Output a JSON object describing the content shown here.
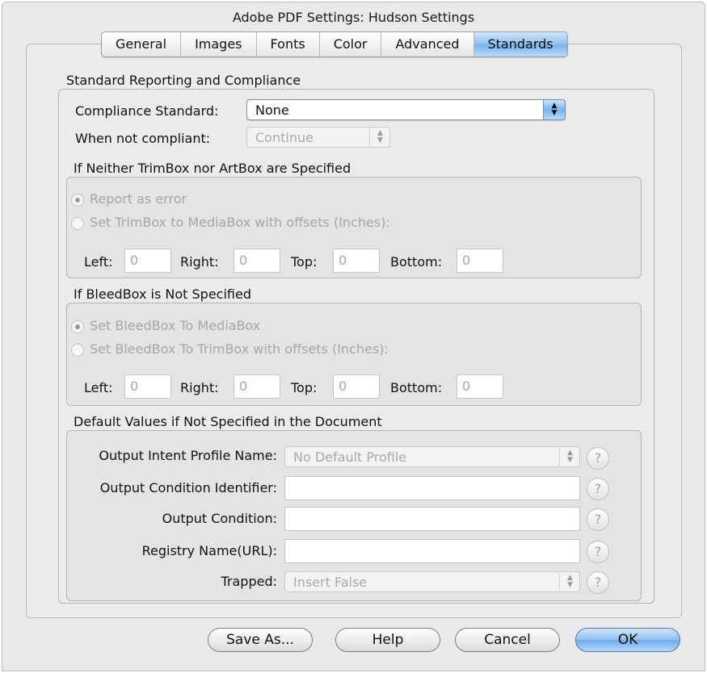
{
  "window": {
    "title": "Adobe PDF Settings: Hudson Settings"
  },
  "tabs": [
    "General",
    "Images",
    "Fonts",
    "Color",
    "Advanced",
    "Standards"
  ],
  "active_tab": "Standards",
  "reporting": {
    "title": "Standard Reporting and Compliance",
    "compliance_label": "Compliance Standard:",
    "compliance_value": "None",
    "not_compliant_label": "When not compliant:",
    "not_compliant_value": "Continue"
  },
  "trimbox": {
    "title": "If Neither TrimBox nor ArtBox are Specified",
    "option_error": "Report as error",
    "option_offsets": "Set TrimBox to MediaBox with offsets (Inches):",
    "left_label": "Left:",
    "left_value": "0",
    "right_label": "Right:",
    "right_value": "0",
    "top_label": "Top:",
    "top_value": "0",
    "bottom_label": "Bottom:",
    "bottom_value": "0"
  },
  "bleedbox": {
    "title": "If BleedBox is Not Specified",
    "option_media": "Set BleedBox To MediaBox",
    "option_offsets": "Set BleedBox To TrimBox with offsets (Inches):",
    "left_label": "Left:",
    "left_value": "0",
    "right_label": "Right:",
    "right_value": "0",
    "top_label": "Top:",
    "top_value": "0",
    "bottom_label": "Bottom:",
    "bottom_value": "0"
  },
  "defaults": {
    "title": "Default Values if Not Specified in the Document",
    "intent_label": "Output Intent Profile Name:",
    "intent_value": "No Default Profile",
    "condition_id_label": "Output Condition Identifier:",
    "condition_id_value": "",
    "condition_label": "Output Condition:",
    "condition_value": "",
    "registry_label": "Registry Name(URL):",
    "registry_value": "",
    "trapped_label": "Trapped:",
    "trapped_value": "Insert False",
    "help_glyph": "?"
  },
  "buttons": {
    "save_as": "Save As...",
    "help": "Help",
    "cancel": "Cancel",
    "ok": "OK"
  },
  "colors": {
    "accent": "#79b2ec",
    "disabled_text": "#a6a6a6"
  }
}
